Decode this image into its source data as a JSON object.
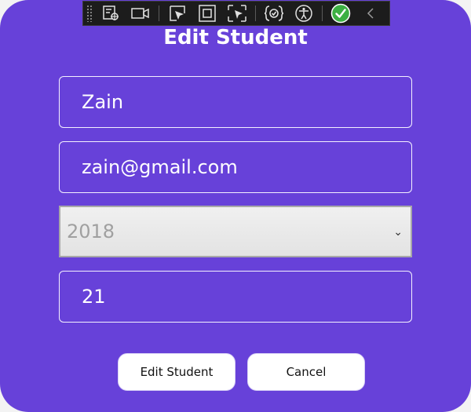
{
  "form": {
    "title": "Edit Student",
    "name_value": "Zain",
    "email_value": "zain@gmail.com",
    "year_selected": "2018",
    "age_value": "21"
  },
  "buttons": {
    "edit_label": "Edit Student",
    "cancel_label": "Cancel"
  },
  "toolbar": {
    "icons": [
      "live-visual-tree-icon",
      "video-icon",
      "select-element-icon",
      "display-layout-adorners-icon",
      "track-focus-icon",
      "binding-failures-icon",
      "accessibility-checker-icon",
      "hot-reload-status-icon",
      "collapse-chevron-icon"
    ]
  },
  "colors": {
    "background": "#6741d9",
    "accent_check": "#3cb043"
  }
}
